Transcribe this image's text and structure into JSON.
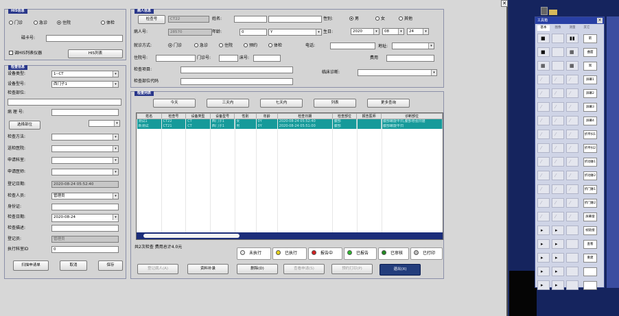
{
  "titlebar_icon": "close-icon",
  "his": {
    "legend": "HIS信息",
    "radios": [
      "门诊",
      "急诊",
      "住院",
      "体检"
    ],
    "selected_index": 2,
    "card_label": "磁卡号:",
    "card_value": "",
    "read_label": "调HIS列表仪器",
    "list_button": "HIS列表"
  },
  "exam": {
    "legend": "检查信息",
    "device_type_label": "设备类型:",
    "device_type_value": "1--CT",
    "device_model_label": "设备型号:",
    "device_model_value": "西门子1",
    "part_label": "检查部位:",
    "part_value": "",
    "case_label": "病 理 号:",
    "case_value": "",
    "select_part_button": "选择部位",
    "method_label": "检查方法:",
    "hospital_label": "送检医院:",
    "dept_label": "申请科室:",
    "doctor_label": "申请医师:",
    "reg_date_label": "登记日期:",
    "reg_date_value": "2020-08-24 05:52:40",
    "operator_label": "检查人员:",
    "operator_value": "管理员",
    "id_label": "身份证:",
    "exam_date_label": "检查日期:",
    "exam_date_value": "2020-08-24",
    "desc_label": "检查描述:",
    "registrar_label": "登记员:",
    "registrar_value": "管理员",
    "dept_id_label": "执行科室ID",
    "dept_id_value": "0"
  },
  "left_buttons": {
    "scan": "扫描申请单",
    "cancel": "取消",
    "save": "保存"
  },
  "patient": {
    "legend": "病人信息",
    "exam_no_button": "检查号",
    "exam_no_value": "CT22",
    "name_label": "姓名:",
    "sex_label": "性别:",
    "sex_options": [
      "男",
      "女",
      "其他"
    ],
    "sex_selected": 0,
    "pid_label": "病人号:",
    "pid_value": "28570",
    "age_label": "年龄:",
    "age_value": "0",
    "age_unit": "Y",
    "birth_label": "生日:",
    "birth_year": "2020",
    "birth_month": "08",
    "birth_day": "24",
    "visit_label": "就诊方式:",
    "visit_options": [
      "门诊",
      "急诊",
      "住院",
      "预约",
      "体检"
    ],
    "visit_selected": 0,
    "phone_label": "电话:",
    "addr_label": "地址:",
    "inpatient_label": "住院号:",
    "outpatient_label": "门诊号:",
    "bed_label": "床号:",
    "fee_label": "费用",
    "item_label": "检查项目:",
    "clinic_label": "临床诊断:",
    "code_label": "检查部位代码"
  },
  "records": {
    "legend": "检查列表",
    "filters": [
      "今天",
      "三天内",
      "七天内",
      "列表",
      "更多查询"
    ],
    "columns": [
      "姓名",
      "检查号",
      "设备类型",
      "设备型号",
      "性别",
      "年龄",
      "检查日期",
      "检查部位",
      "报告医师",
      "诊断部位"
    ],
    "rows": [
      [
        "测试1",
        "CT22",
        "CT",
        "西门子1",
        "女",
        "0Y",
        "2020-08-24 05:52:40",
        "腹部",
        "",
        "腹部螺旋平扫,腹部增强扫描"
      ],
      [
        "新测试",
        "CT21",
        "CT",
        "西门子1",
        "男",
        "0Y",
        "2020-08-24 05:51:00",
        "腹部",
        "",
        "腹部螺旋平扫"
      ]
    ],
    "summary": "共2次检查   费用总计4.0元"
  },
  "status_legend": [
    {
      "label": "未执行",
      "color": "#e8e8e8"
    },
    {
      "label": "已执行",
      "color": "#e6d21a"
    },
    {
      "label": "报告中",
      "color": "#d21f1f"
    },
    {
      "label": "已报告",
      "color": "#2db82d"
    },
    {
      "label": "已审核",
      "color": "#1f8a1f"
    },
    {
      "label": "已打印",
      "color": "#bdbdbd"
    }
  ],
  "bottom_buttons": {
    "register": "登记病人(A)",
    "edit": "资料补录",
    "delete": "删除(D)",
    "view_apply": "查看申请(S)",
    "print_apply": "预约打印(P)",
    "exit": "退出(X)"
  },
  "toolbox": {
    "title": "工具箱",
    "tabs": [
      "基本",
      "图像",
      "测量",
      "其它"
    ],
    "labels": [
      "箭",
      "曲面",
      "耳",
      "屏幕1",
      "屏幕2",
      "屏幕3",
      "屏幕4",
      "折平扫1",
      "折平扫2",
      "折动脉1",
      "折动脉2",
      "折门脉1",
      "折门脉2",
      "屏幕窗",
      "帧链接",
      "查看",
      "重建",
      "",
      ""
    ]
  }
}
